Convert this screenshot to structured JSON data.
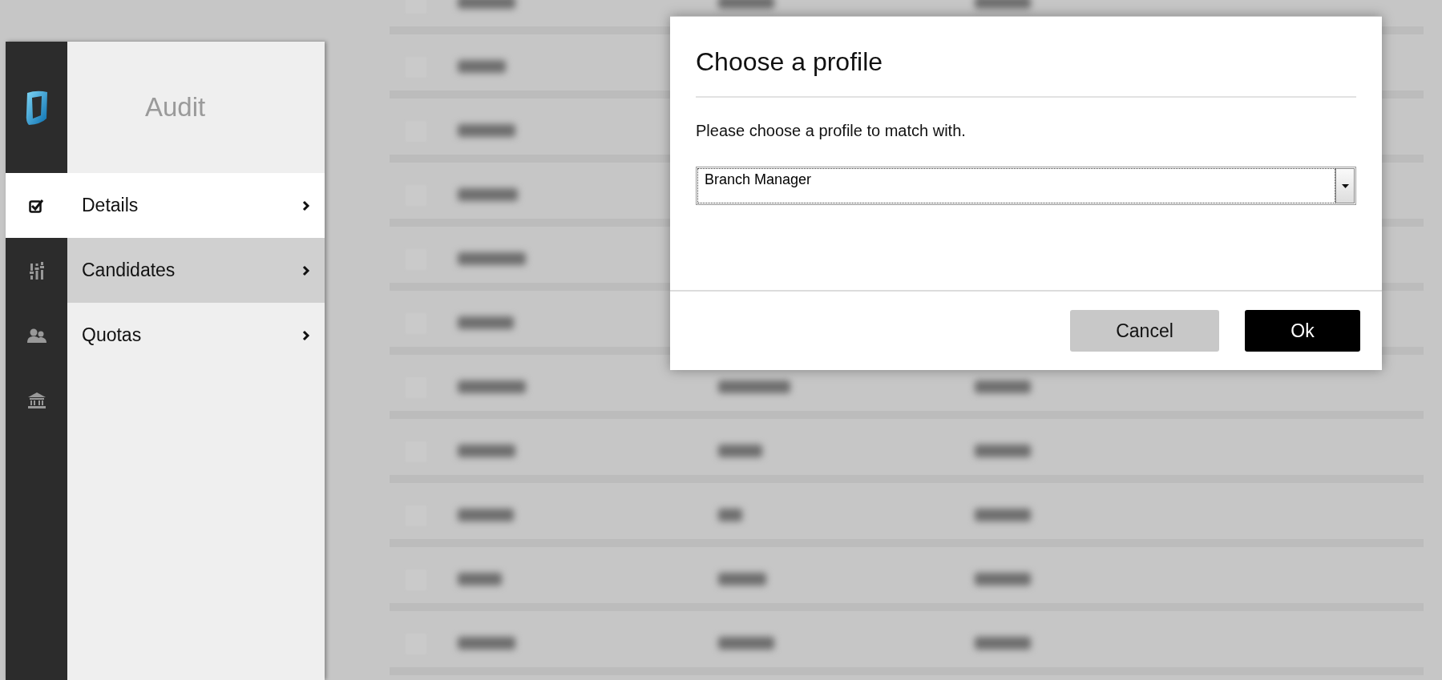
{
  "sidebar": {
    "title": "Audit",
    "items": [
      {
        "label": "Details",
        "active": true,
        "selected": false
      },
      {
        "label": "Candidates",
        "active": false,
        "selected": true
      },
      {
        "label": "Quotas",
        "active": false,
        "selected": false
      }
    ]
  },
  "dialog": {
    "title": "Choose a profile",
    "message": "Please choose a profile to match with.",
    "profile_select": {
      "value": "Branch Manager"
    },
    "buttons": [
      {
        "label": "Cancel",
        "kind": "secondary"
      },
      {
        "label": "Ok",
        "kind": "primary"
      }
    ]
  }
}
